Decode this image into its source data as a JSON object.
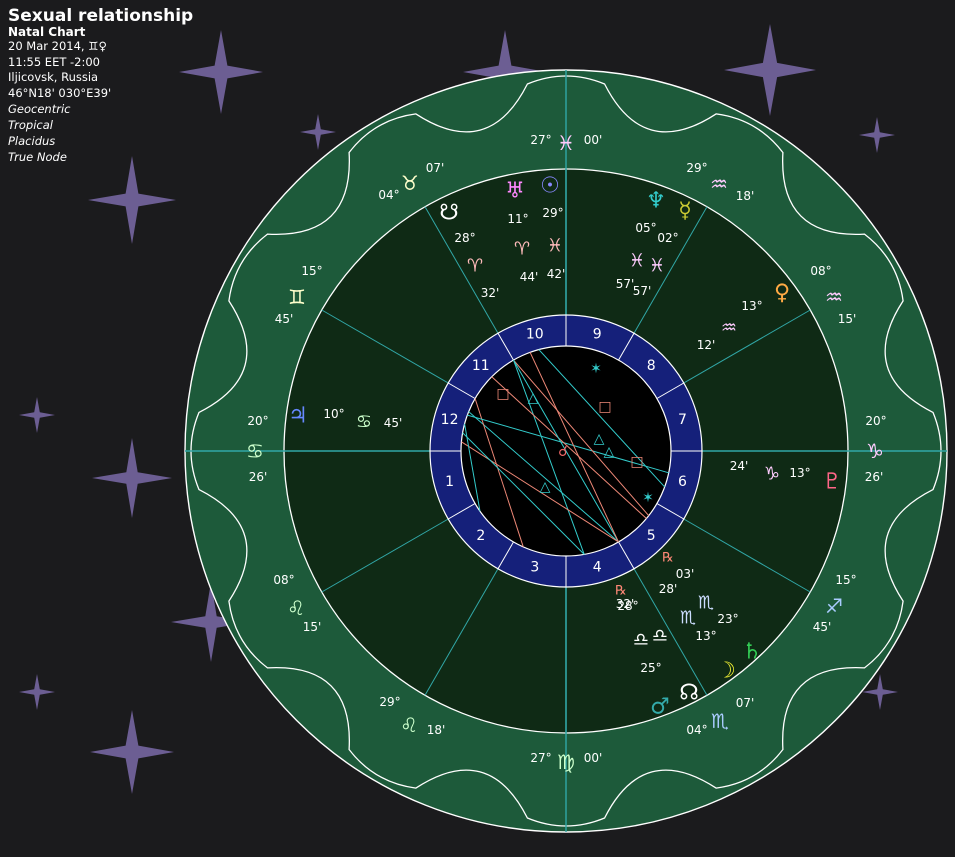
{
  "header": {
    "title": "Sexual relationship",
    "subtitle": "Natal Chart",
    "date": "20 Mar 2014, ♊♀",
    "time": "11:55  EET -2:00",
    "place": "Iljicovsk, Russia",
    "coords": "46°N18' 030°E39'",
    "options": [
      "Geocentric",
      "Tropical",
      "Placidus",
      "True Node"
    ]
  },
  "colors": {
    "background": "#1b1b1d",
    "star": "#7a6aa8",
    "zodiac_ring": "#1d5a3a",
    "house_ring": "#0f2a15",
    "house_number_ring": "#15207a",
    "center": "#000000",
    "cusp_line": "#31a7a7",
    "trine": "#33cccc",
    "square": "#ee8877",
    "sextile": "#33cccc"
  },
  "house_numbers": [
    "1",
    "2",
    "3",
    "4",
    "5",
    "6",
    "7",
    "8",
    "9",
    "10",
    "11",
    "12"
  ],
  "house_cusps": [
    {
      "deg": "20°",
      "sign": "♋",
      "min": "26'",
      "color": "#ccffcc"
    },
    {
      "deg": "08°",
      "sign": "♌",
      "min": "15'",
      "color": "#ccffcc"
    },
    {
      "deg": "29°",
      "sign": "♌",
      "min": "18'",
      "color": "#ccffcc"
    },
    {
      "deg": "27°",
      "sign": "♍",
      "min": "00'",
      "color": "#ccffcc"
    },
    {
      "deg": "04°",
      "sign": "♏",
      "min": "07'",
      "color": "#aaccff"
    },
    {
      "deg": "15°",
      "sign": "♐",
      "min": "45'",
      "color": "#aaccff"
    },
    {
      "deg": "20°",
      "sign": "♑",
      "min": "26'",
      "color": "#ffccff"
    },
    {
      "deg": "08°",
      "sign": "♒",
      "min": "15'",
      "color": "#ffccff"
    },
    {
      "deg": "29°",
      "sign": "♒",
      "min": "18'",
      "color": "#ffccff"
    },
    {
      "deg": "27°",
      "sign": "♓",
      "min": "00'",
      "color": "#ffccff"
    },
    {
      "deg": "04°",
      "sign": "♉",
      "min": "07'",
      "color": "#ffffcc"
    },
    {
      "deg": "15°",
      "sign": "♊",
      "min": "45'",
      "color": "#ffffcc"
    }
  ],
  "planets": [
    {
      "name": "Node",
      "glyph": "☋",
      "deg": "28°",
      "sign": "♈",
      "min": "32'",
      "glyph_color": "#ffffff",
      "sign_color": "#ffbbbb",
      "rx": ""
    },
    {
      "name": "Uranus",
      "glyph": "♅",
      "deg": "11°",
      "sign": "♈",
      "min": "44'",
      "glyph_color": "#ff88ff",
      "sign_color": "#ffbbbb",
      "rx": ""
    },
    {
      "name": "Sun",
      "glyph": "☉",
      "deg": "29°",
      "sign": "♓",
      "min": "42'",
      "glyph_color": "#8888ff",
      "sign_color": "#ffbbbb",
      "rx": ""
    },
    {
      "name": "Neptune",
      "glyph": "♆",
      "deg": "05°",
      "sign": "♓",
      "min": "57'",
      "glyph_color": "#33cccc",
      "sign_color": "#ffccff",
      "rx": ""
    },
    {
      "name": "Mercury",
      "glyph": "☿",
      "deg": "02°",
      "sign": "♓",
      "min": "57'",
      "glyph_color": "#cccc33",
      "sign_color": "#ffccff",
      "rx": ""
    },
    {
      "name": "Venus",
      "glyph": "♀",
      "deg": "13°",
      "sign": "♒",
      "min": "12'",
      "glyph_color": "#ffaa44",
      "sign_color": "#ffccff",
      "rx": ""
    },
    {
      "name": "Pluto",
      "glyph": "♇",
      "deg": "13°",
      "sign": "♑",
      "min": "24'",
      "glyph_color": "#ff6688",
      "sign_color": "#ffccff",
      "rx": ""
    },
    {
      "name": "Saturn",
      "glyph": "♄",
      "deg": "23°",
      "sign": "♏",
      "min": "03'",
      "glyph_color": "#33cc55",
      "sign_color": "#ccddff",
      "rx": "℞"
    },
    {
      "name": "Moon",
      "glyph": "☽",
      "deg": "13°",
      "sign": "♏",
      "min": "28'",
      "glyph_color": "#eeee33",
      "sign_color": "#ccddff",
      "rx": ""
    },
    {
      "name": "Mars",
      "glyph": "♂",
      "deg": "28°",
      "sign": "♎",
      "min": "32'",
      "glyph_color": "#33aaaa",
      "sign_color": "#ffffff",
      "rx": "℞"
    },
    {
      "name": "True Node",
      "glyph": "☊",
      "deg": "25°",
      "sign": "♎",
      "min": "",
      "glyph_color": "#ffffff",
      "sign_color": "#ffffff",
      "rx": ""
    },
    {
      "name": "Jupiter",
      "glyph": "♃",
      "deg": "10°",
      "sign": "♋",
      "min": "45'",
      "glyph_color": "#6688ff",
      "sign_color": "#ccffcc",
      "rx": ""
    }
  ],
  "aspect_symbols": {
    "trine": "△",
    "square": "□",
    "sextile": "✶",
    "conjunction": "☌"
  }
}
